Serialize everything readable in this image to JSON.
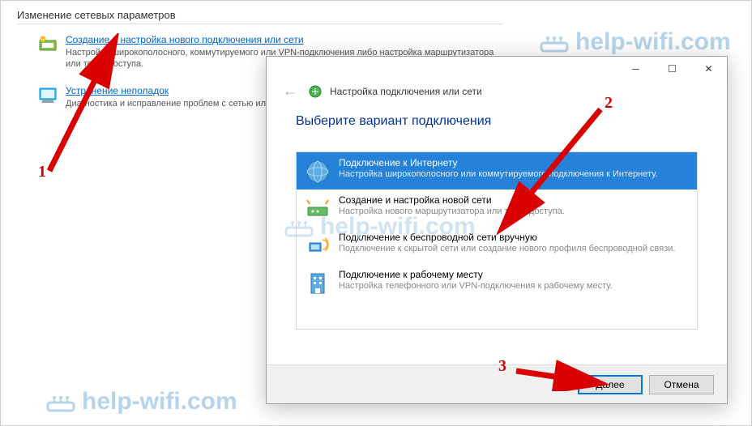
{
  "background": {
    "section_title": "Изменение сетевых параметров",
    "items": [
      {
        "link": "Создание и настройка нового подключения или сети",
        "desc": "Настройка широкополосного, коммутируемого или VPN-подключения либо настройка маршрутизатора или точки доступа."
      },
      {
        "link": "Устранение неполадок",
        "desc": "Диагностика и исправление проблем с сетью или получение сведений об устранении неполадок."
      }
    ]
  },
  "dialog": {
    "header": "Настройка подключения или сети",
    "title": "Выберите вариант подключения",
    "options": [
      {
        "title": "Подключение к Интернету",
        "desc": "Настройка широкополосного или коммутируемого подключения к Интернету."
      },
      {
        "title": "Создание и настройка новой сети",
        "desc": "Настройка нового маршрутизатора или точки доступа."
      },
      {
        "title": "Подключение к беспроводной сети вручную",
        "desc": "Подключение к скрытой сети или создание нового профиля беспроводной связи."
      },
      {
        "title": "Подключение к рабочему месту",
        "desc": "Настройка телефонного или VPN-подключения к рабочему месту."
      }
    ],
    "buttons": {
      "next": "Далее",
      "cancel": "Отмена"
    }
  },
  "watermark": "help-wifi.com",
  "annotations": {
    "n1": "1",
    "n2": "2",
    "n3": "3"
  }
}
